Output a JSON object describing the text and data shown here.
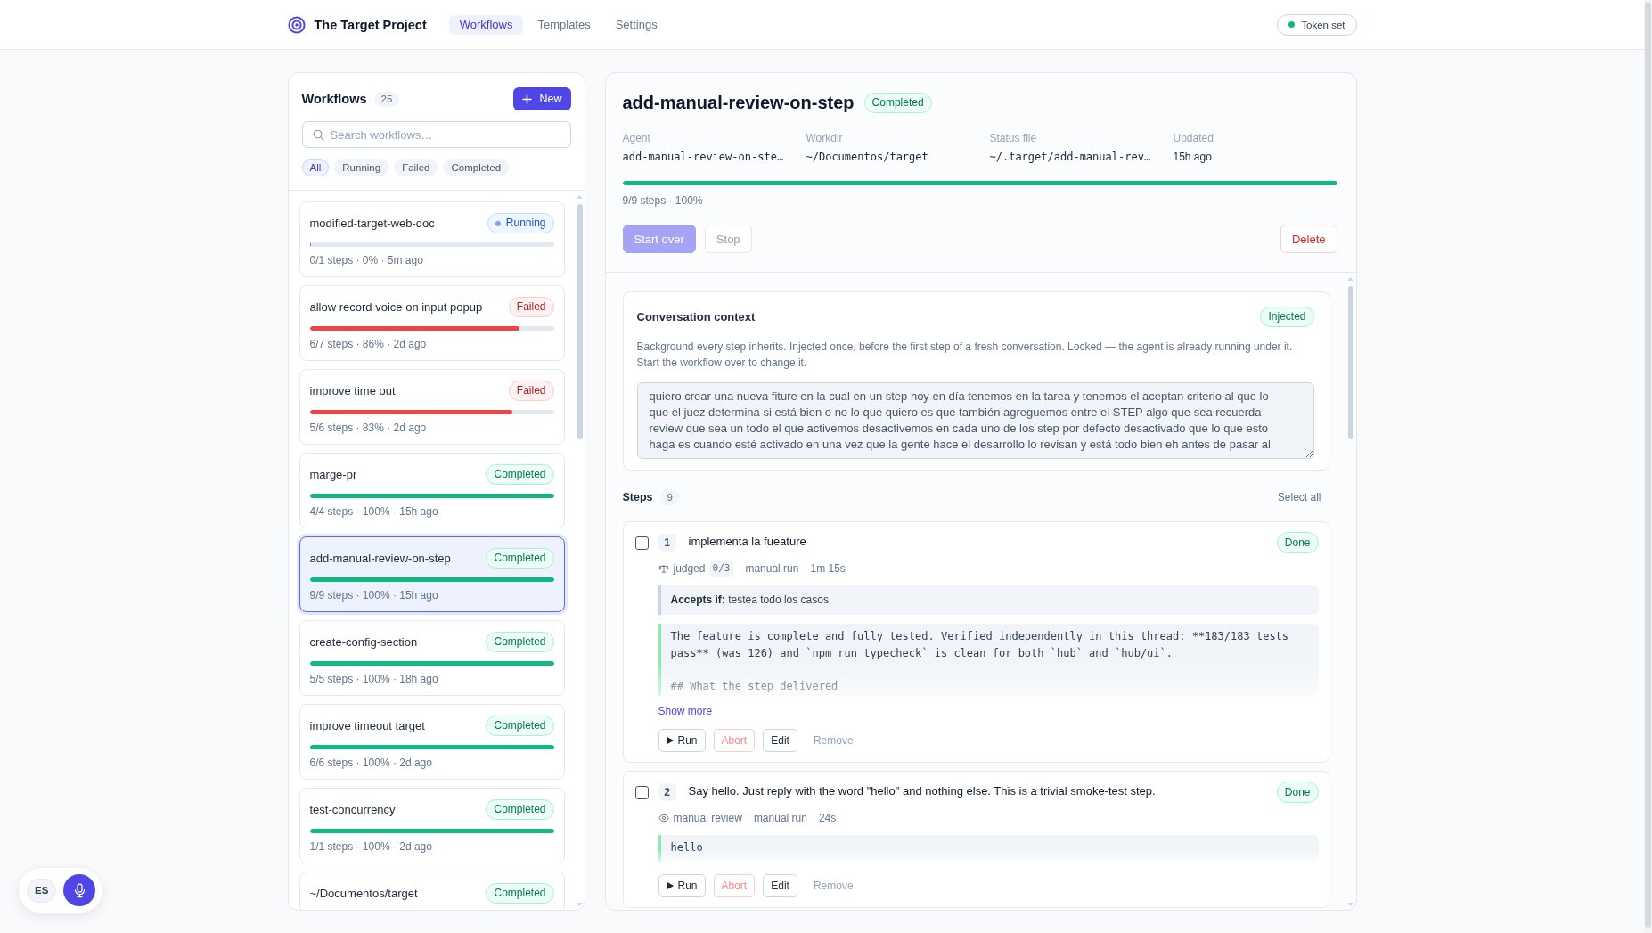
{
  "top_bar": {
    "brand": "The Target Project",
    "nav": [
      {
        "label": "Workflows",
        "selected": true
      },
      {
        "label": "Templates",
        "selected": false
      },
      {
        "label": "Settings",
        "selected": false
      }
    ],
    "token": {
      "label": "Token set",
      "ok": true
    }
  },
  "sidebar": {
    "title": "Workflows",
    "count": "25",
    "new_button": "New",
    "search": {
      "placeholder": "Search workflows…"
    },
    "filters": [
      {
        "label": "All",
        "selected": true
      },
      {
        "label": "Running",
        "selected": false
      },
      {
        "label": "Failed",
        "selected": false
      },
      {
        "label": "Completed",
        "selected": false
      }
    ],
    "workflows": [
      {
        "name": "modified-target-web-doc",
        "badge": {
          "label": "Running",
          "kind": "running"
        },
        "level": 0,
        "meta": "0/1 steps · 0% · 5m ago",
        "selected": false
      },
      {
        "name": "allow record voice on input popup",
        "badge": {
          "label": "Failed",
          "kind": "failed"
        },
        "level": 0.86,
        "meta": "6/7 steps · 86% · 2d ago",
        "selected": false
      },
      {
        "name": "improve time out",
        "badge": {
          "label": "Failed",
          "kind": "failed"
        },
        "level": 0.83,
        "meta": "5/6 steps · 83% · 2d ago",
        "selected": false
      },
      {
        "name": "marge-pr",
        "badge": {
          "label": "Completed",
          "kind": "completed"
        },
        "level": 1,
        "meta": "4/4 steps · 100% · 15h ago",
        "selected": false
      },
      {
        "name": "add-manual-review-on-step",
        "badge": {
          "label": "Completed",
          "kind": "completed"
        },
        "level": 1,
        "meta": "9/9 steps · 100% · 15h ago",
        "selected": true
      },
      {
        "name": "create-config-section",
        "badge": {
          "label": "Completed",
          "kind": "completed"
        },
        "level": 1,
        "meta": "5/5 steps · 100% · 18h ago",
        "selected": false
      },
      {
        "name": "improve timeout target",
        "badge": {
          "label": "Completed",
          "kind": "completed"
        },
        "level": 1,
        "meta": "6/6 steps · 100% · 2d ago",
        "selected": false
      },
      {
        "name": "test-concurrency",
        "badge": {
          "label": "Completed",
          "kind": "completed"
        },
        "level": 1,
        "meta": "1/1 steps · 100% · 2d ago",
        "selected": false
      },
      {
        "name": "~/Documentos/target",
        "badge": {
          "label": "Completed",
          "kind": "completed"
        },
        "selected": false
      }
    ]
  },
  "detail": {
    "title": "add-manual-review-on-step",
    "badge": {
      "label": "Completed",
      "kind": "completed"
    },
    "fields": [
      {
        "label": "Agent",
        "value": "add-manual-review-on-ste…",
        "kind": "code"
      },
      {
        "label": "Workdir",
        "value": "~/Documentos/target",
        "kind": "code"
      },
      {
        "label": "Status file",
        "value": "~/.target/add-manual-rev…",
        "kind": "code"
      },
      {
        "label": "Updated",
        "value": "15h ago",
        "kind": "text"
      }
    ],
    "level": 1,
    "progress_text": "9/9 steps · 100%",
    "actions": [
      {
        "label": "Start over",
        "kind": "restart",
        "disabled": true
      },
      {
        "label": "Stop",
        "kind": "stop",
        "disabled": true
      },
      {
        "label": "Delete",
        "kind": "delete",
        "disabled": false
      }
    ],
    "context": {
      "title": "Conversation context",
      "badge": "Injected",
      "description": "Background every step inherits. Injected once, before the first step of a fresh conversation. Locked — the agent is already running under it. Start the workflow over to change it.",
      "text": "quiero crear una nueva fiture en la cual en un step hoy en día tenemos en la tarea y tenemos el aceptan criterio al que lo que el juez determina si está bien o no lo que quiero es que también agreguemos entre el STEP algo que sea recuerda review que sea un todo el que activemos desactivemos en cada uno de los step por defecto desactivado que lo que esto haga es cuando esté activado en una vez que la gente hace el desarrollo lo revisan y está todo bien eh antes de pasar al",
      "disabled": true
    },
    "steps_header": {
      "title": "Steps",
      "count": "9",
      "select_all": "Select all"
    },
    "steps": [
      {
        "number": "1",
        "checked": false,
        "title": "implementa la fueature",
        "badge": {
          "label": "Done",
          "kind": "done"
        },
        "review": {
          "kind": "judged",
          "label": "judged",
          "count": "0/3"
        },
        "run_mode": "manual run",
        "duration": "1m 15s",
        "accepts": "**Accepts if:** testea todo los casos",
        "output": "The feature is complete and fully tested. Verified independently in this thread: **183/183 tests pass** (was 126) and `npm run typecheck` is clean for both `hub` and `hub/ui`.\n\n## What the step delivered",
        "show_more": "Show more",
        "buttons": [
          {
            "label": "Run",
            "kind": "run",
            "disabled": false
          },
          {
            "label": "Abort",
            "kind": "abort",
            "disabled": true
          },
          {
            "label": "Edit",
            "kind": "edit",
            "disabled": false
          },
          {
            "label": "Remove",
            "kind": "remove",
            "disabled": true
          }
        ]
      },
      {
        "number": "2",
        "checked": false,
        "title": "Say hello. Just reply with the word \"hello\" and nothing else. This is a trivial smoke-test step.",
        "badge": {
          "label": "Done",
          "kind": "done"
        },
        "review": {
          "kind": "manual",
          "label": "manual review"
        },
        "run_mode": "manual run",
        "duration": "24s",
        "output": "hello",
        "buttons": [
          {
            "label": "Run",
            "kind": "run",
            "disabled": false
          },
          {
            "label": "Abort",
            "kind": "abort",
            "disabled": true
          },
          {
            "label": "Edit",
            "kind": "edit",
            "disabled": false
          },
          {
            "label": "Remove",
            "kind": "remove",
            "disabled": true
          }
        ]
      }
    ]
  },
  "voice_widget": {
    "language": "ES"
  }
}
